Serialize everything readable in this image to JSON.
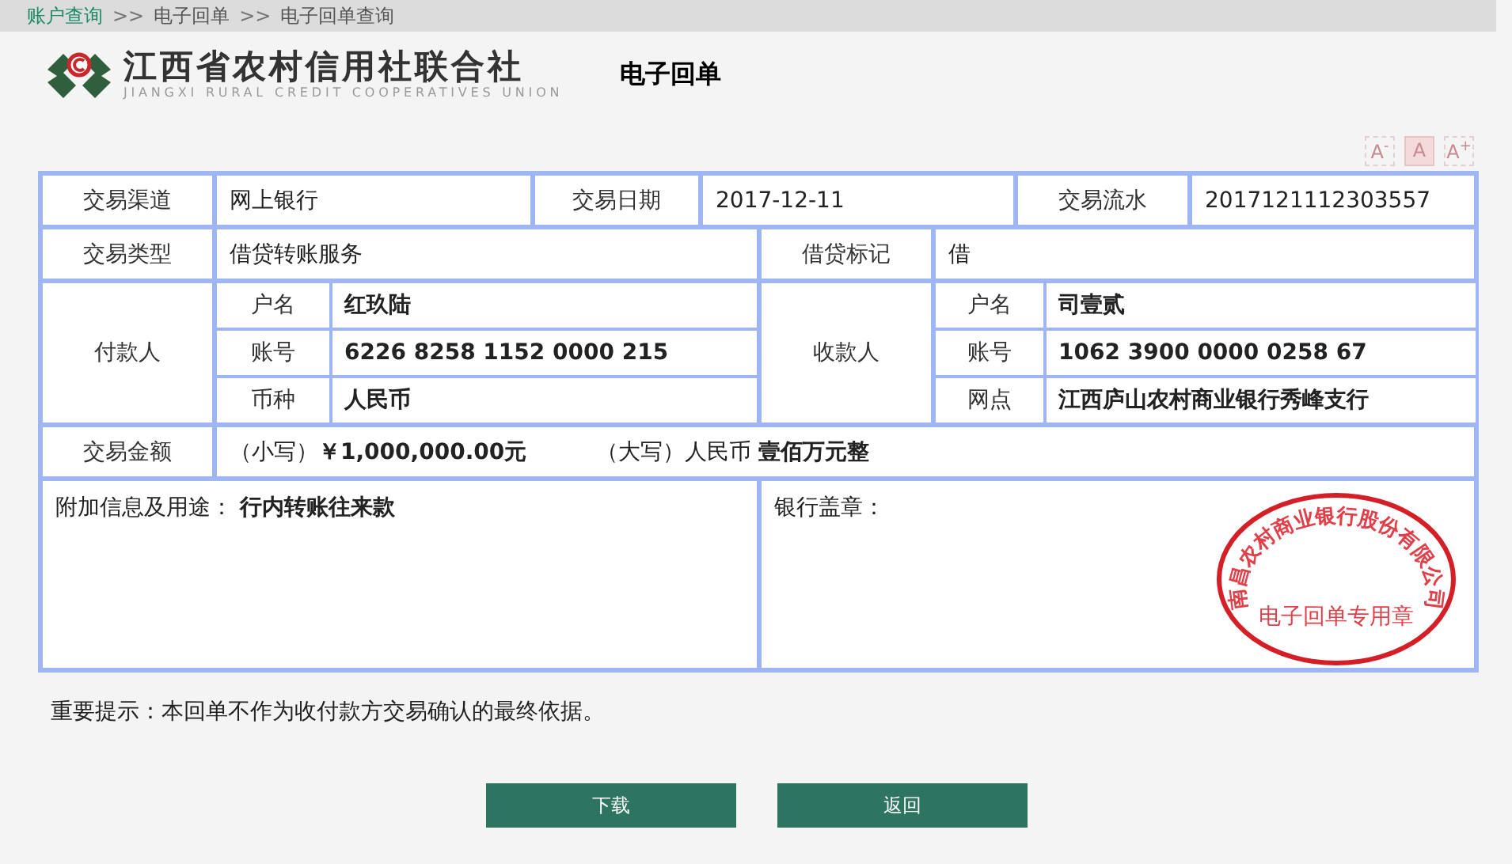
{
  "breadcrumb": {
    "separator": ">>",
    "items": [
      {
        "label": "账户查询",
        "kind": "link"
      },
      {
        "label": "电子回单",
        "kind": "plain"
      },
      {
        "label": "电子回单查询",
        "kind": "plain"
      }
    ]
  },
  "header": {
    "org_name": "江西省农村信用社联合社",
    "org_name_en": "JIANGXI RURAL CREDIT COOPERATIVES UNION",
    "title": "电子回单"
  },
  "font_size_buttons": [
    {
      "label": "A$^{-}$",
      "selected": false
    },
    {
      "label": "A",
      "selected": true
    },
    {
      "label": "A$^{+}$",
      "selected": false
    }
  ],
  "receipt": {
    "channel": {
      "label": "交易渠道",
      "value": "网上银行"
    },
    "date": {
      "label": "交易日期",
      "value": "2017-12-11"
    },
    "serial": {
      "label": "交易流水",
      "value": "2017121112303557"
    },
    "type": {
      "label": "交易类型",
      "value": "借贷转账服务"
    },
    "dc_flag": {
      "label": "借贷标记",
      "value": "借"
    },
    "payer": {
      "label": "付款人",
      "rows": [
        {
          "label": "户名",
          "value": "红玖陆"
        },
        {
          "label": "账号",
          "value": "6226 8258 1152 0000 215"
        },
        {
          "label": "币种",
          "value": "人民币"
        }
      ]
    },
    "payee": {
      "label": "收款人",
      "rows": [
        {
          "label": "户名",
          "value": "司壹贰"
        },
        {
          "label": "账号",
          "value": "1062 3900 0000 0258 67"
        },
        {
          "label": "网点",
          "value": "江西庐山农村商业银行秀峰支行"
        }
      ]
    },
    "amount": {
      "label": "交易金额",
      "small_label": "（小写）",
      "small_value": "￥1,000,000.00元",
      "big_label": "（大写）人民币",
      "big_value": "壹佰万元整"
    },
    "memo": {
      "label": "附加信息及用途：",
      "value": "行内转账往来款"
    },
    "stamp": {
      "label": "银行盖章：",
      "seal_arc": "南昌农村商业银行股份有限公司",
      "seal_center": "电子回单专用章"
    }
  },
  "notice": "重要提示：本回单不作为收付款方交易确认的最终依据。",
  "buttons": [
    "下载",
    "返回"
  ]
}
